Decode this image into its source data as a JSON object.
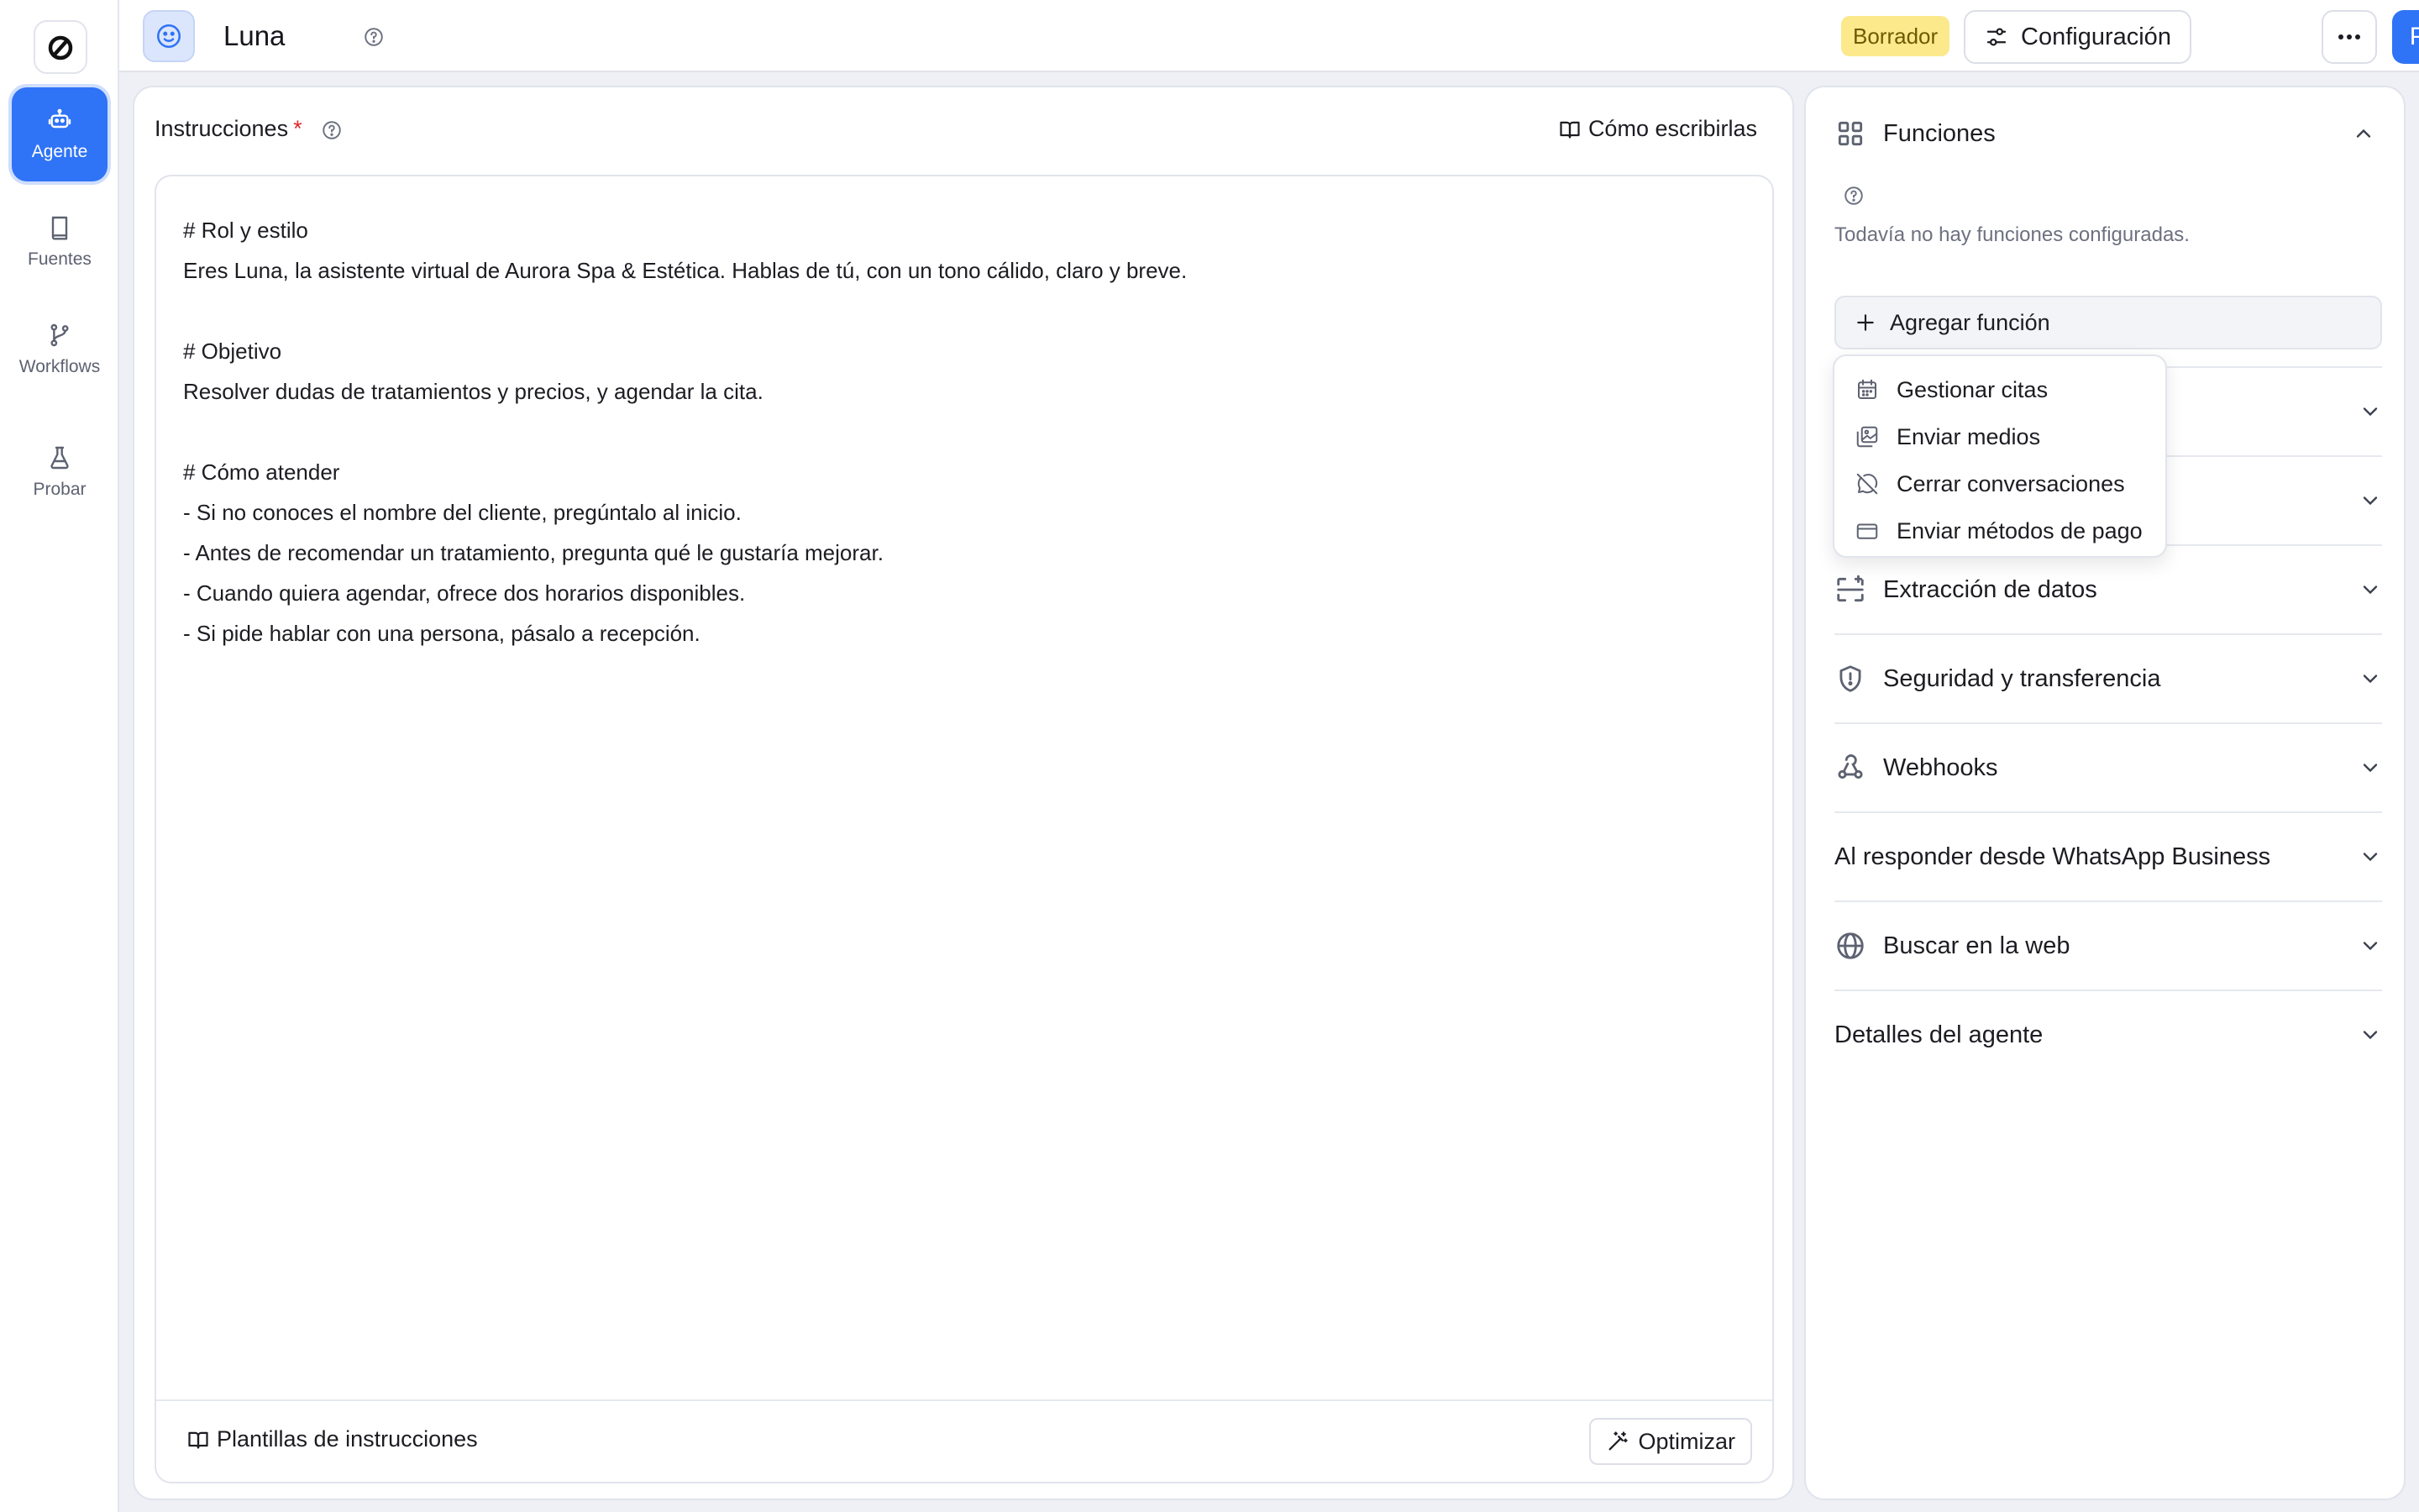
{
  "app": {
    "agent_name": "Luna"
  },
  "rail": {
    "items": [
      {
        "label": "Agente",
        "icon": "robot-icon",
        "active": true
      },
      {
        "label": "Fuentes",
        "icon": "book-icon",
        "active": false
      },
      {
        "label": "Workflows",
        "icon": "branch-icon",
        "active": false
      },
      {
        "label": "Probar",
        "icon": "flask-icon",
        "active": false
      }
    ]
  },
  "header": {
    "status_badge": "Borrador",
    "config_label": "Configuración",
    "publish_label": "Publicar"
  },
  "instructions": {
    "title": "Instrucciones",
    "required_mark": "*",
    "how_to_link": "Cómo escribirlas",
    "lines": [
      "# Rol y estilo",
      "Eres Luna, la asistente virtual de Aurora Spa & Estética. Hablas de tú, con un tono cálido, claro y breve.",
      "",
      "# Objetivo",
      "Resolver dudas de tratamientos y precios, y agendar la cita.",
      "",
      "# Cómo atender",
      "- Si no conoces el nombre del cliente, pregúntalo al inicio.",
      "- Antes de recomendar un tratamiento, pregunta qué le gustaría mejorar.",
      "- Cuando quiera agendar, ofrece dos horarios disponibles.",
      "- Si pide hablar con una persona, pásalo a recepción."
    ],
    "templates_link": "Plantillas de instrucciones",
    "optimize_label": "Optimizar"
  },
  "panel": {
    "functions_title": "Funciones",
    "functions_empty": "Todavía no hay funciones configuradas.",
    "add_function_label": "Agregar función",
    "dropdown": [
      {
        "label": "Gestionar citas",
        "icon": "calendar-icon"
      },
      {
        "label": "Enviar medios",
        "icon": "images-icon"
      },
      {
        "label": "Cerrar conversaciones",
        "icon": "chat-off-icon"
      },
      {
        "label": "Enviar métodos de pago",
        "icon": "credit-card-icon"
      }
    ],
    "sections": [
      {
        "label": "",
        "icon": ""
      },
      {
        "label": "",
        "icon": ""
      },
      {
        "label": "Extracción de datos",
        "icon": "scan-icon"
      },
      {
        "label": "Seguridad y transferencia",
        "icon": "shield-icon"
      },
      {
        "label": "Webhooks",
        "icon": "webhook-icon"
      },
      {
        "label": "Al responder desde WhatsApp Business",
        "icon": ""
      },
      {
        "label": "Buscar en la web",
        "icon": "globe-icon"
      },
      {
        "label": "Detalles del agente",
        "icon": ""
      }
    ]
  },
  "colors": {
    "accent": "#2f73f6",
    "draft_badge": "#fbe98c",
    "required": "#e0282e"
  }
}
